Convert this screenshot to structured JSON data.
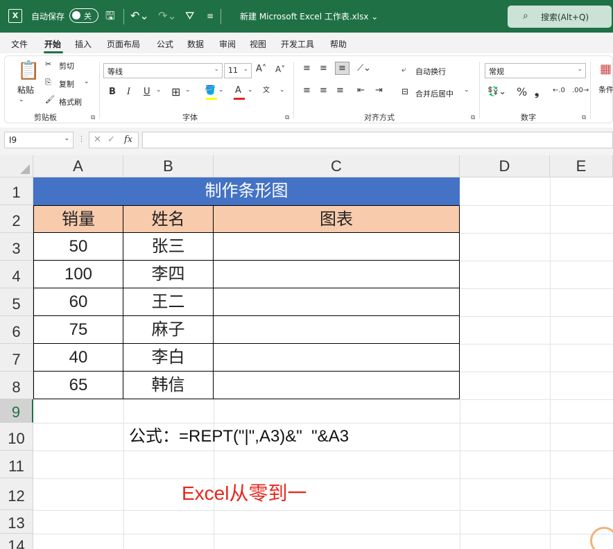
{
  "titlebar": {
    "autosave_label": "自动保存",
    "autosave_state": "关",
    "doc_title": "新建 Microsoft Excel 工作表.xlsx ⌄",
    "search": "搜索(Alt+Q)"
  },
  "menu": [
    "文件",
    "开始",
    "插入",
    "页面布局",
    "公式",
    "数据",
    "审阅",
    "视图",
    "开发工具",
    "帮助"
  ],
  "ribbon": {
    "paste": "粘贴",
    "cut": "剪切",
    "copy": "复制",
    "format_painter": "格式刷",
    "clipboard_label": "剪贴板",
    "font_name": "等线",
    "font_size": "11",
    "font_label": "字体",
    "wrap_text": "自动换行",
    "merge_center": "合并后居中",
    "align_label": "对齐方式",
    "number_format": "常规",
    "number_label": "数字",
    "conditional": "条件"
  },
  "formula_bar": {
    "name_box": "I9",
    "fx": "fx",
    "formula": ""
  },
  "columns": [
    "A",
    "B",
    "C",
    "D",
    "E"
  ],
  "rows": [
    "1",
    "2",
    "3",
    "4",
    "5",
    "6",
    "7",
    "8",
    "9",
    "10",
    "11",
    "12",
    "13",
    "14"
  ],
  "table": {
    "title": "制作条形图",
    "headers": [
      "销量",
      "姓名",
      "图表"
    ],
    "rows": [
      [
        "50",
        "张三",
        ""
      ],
      [
        "100",
        "李四",
        ""
      ],
      [
        "60",
        "王二",
        ""
      ],
      [
        "75",
        "麻子",
        ""
      ],
      [
        "40",
        "李白",
        ""
      ],
      [
        "65",
        "韩信",
        ""
      ]
    ]
  },
  "notes": {
    "formula_text": "公式：=REPT(\"|\",A3)&\"  \"&A3",
    "watermark": "Excel从零到一",
    "watermark_color": "#e8251b"
  },
  "colors": {
    "title_fill": "#4472c4",
    "header_fill": "#f8cbad",
    "excel_green": "#1f7145"
  }
}
